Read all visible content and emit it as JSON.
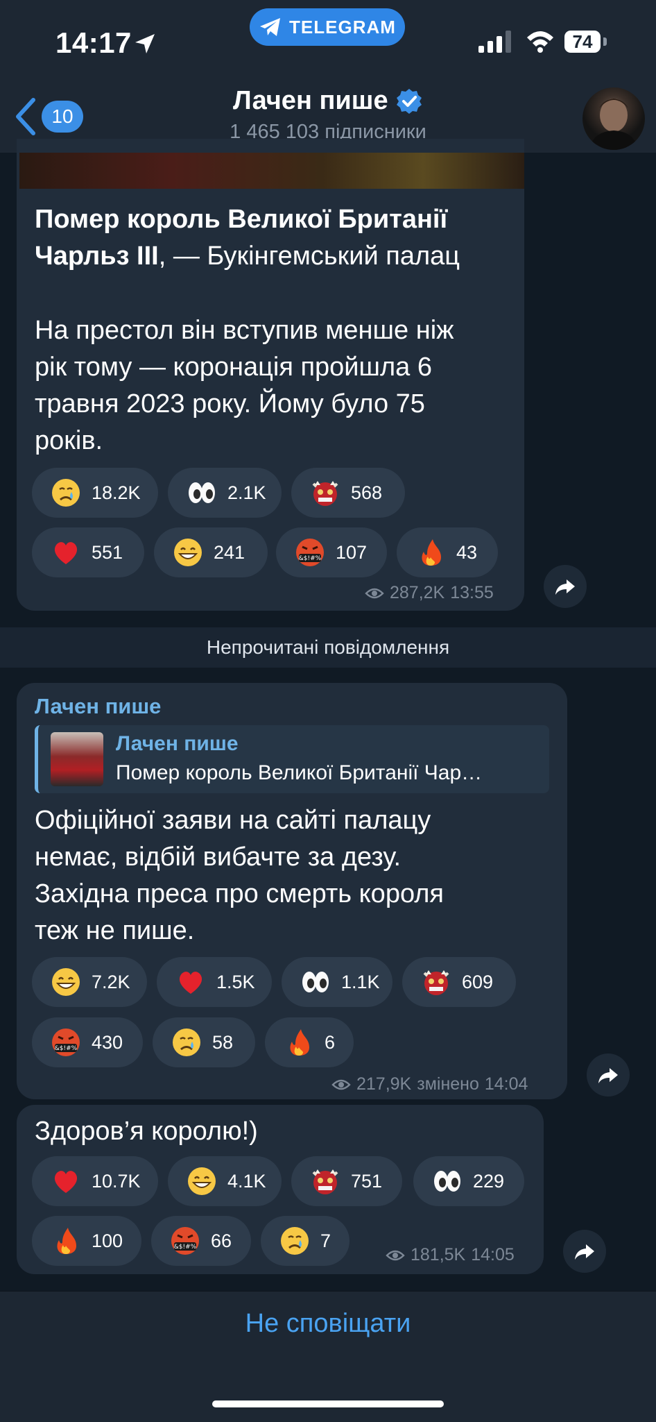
{
  "status_bar": {
    "time": "14:17",
    "pill_label": "TELEGRAM",
    "battery": "74"
  },
  "header": {
    "back_count": "10",
    "title": "Лачен пише",
    "subscribers": "1 465 103 підписники"
  },
  "messages": [
    {
      "title_bold": "Помер король Великої Британії Чарльз III",
      "title_rest": ", — Букінгемський палац",
      "body_line1": "На престол він вступив менше ніж",
      "body_line2": "рік тому — коронація пройшла 6",
      "body_line3": "травня 2023 року. Йому було 75",
      "body_line4": "років.",
      "reactions": [
        {
          "emoji": "crying-face",
          "count": "18.2K"
        },
        {
          "emoji": "eyes",
          "count": "2.1K"
        },
        {
          "emoji": "ogre-mask",
          "count": "568"
        },
        {
          "emoji": "red-heart",
          "count": "551"
        },
        {
          "emoji": "grinning-face",
          "count": "241"
        },
        {
          "emoji": "cursing-face",
          "count": "107"
        },
        {
          "emoji": "fire",
          "count": "43"
        }
      ],
      "views": "287,2K",
      "time": "13:55"
    },
    {
      "author": "Лачен пише",
      "reply_author": "Лачен пише",
      "reply_text": "Помер король Великої Британії Чар…",
      "body_line1": "Офіційної заяви на сайті палацу",
      "body_line2": "немає, відбій вибачте за дезу.",
      "body_line3": "Західна преса про смерть короля",
      "body_line4": "теж не пише.",
      "reactions": [
        {
          "emoji": "grinning-face",
          "count": "7.2K"
        },
        {
          "emoji": "red-heart",
          "count": "1.5K"
        },
        {
          "emoji": "eyes",
          "count": "1.1K"
        },
        {
          "emoji": "ogre-mask",
          "count": "609"
        },
        {
          "emoji": "cursing-face",
          "count": "430"
        },
        {
          "emoji": "crying-face",
          "count": "58"
        },
        {
          "emoji": "fire",
          "count": "6"
        }
      ],
      "views": "217,9K",
      "edited_label": "змінено",
      "time": "14:04"
    },
    {
      "body_line1": "Здоров’я королю!)",
      "reactions": [
        {
          "emoji": "red-heart",
          "count": "10.7K"
        },
        {
          "emoji": "grinning-face",
          "count": "4.1K"
        },
        {
          "emoji": "ogre-mask",
          "count": "751"
        },
        {
          "emoji": "eyes",
          "count": "229"
        },
        {
          "emoji": "fire",
          "count": "100"
        },
        {
          "emoji": "cursing-face",
          "count": "66"
        },
        {
          "emoji": "crying-face",
          "count": "7"
        }
      ],
      "views": "181,5K",
      "time": "14:05"
    }
  ],
  "unread_label": "Непрочитані повідомлення",
  "footer": {
    "mute_label": "Не сповіщати"
  }
}
